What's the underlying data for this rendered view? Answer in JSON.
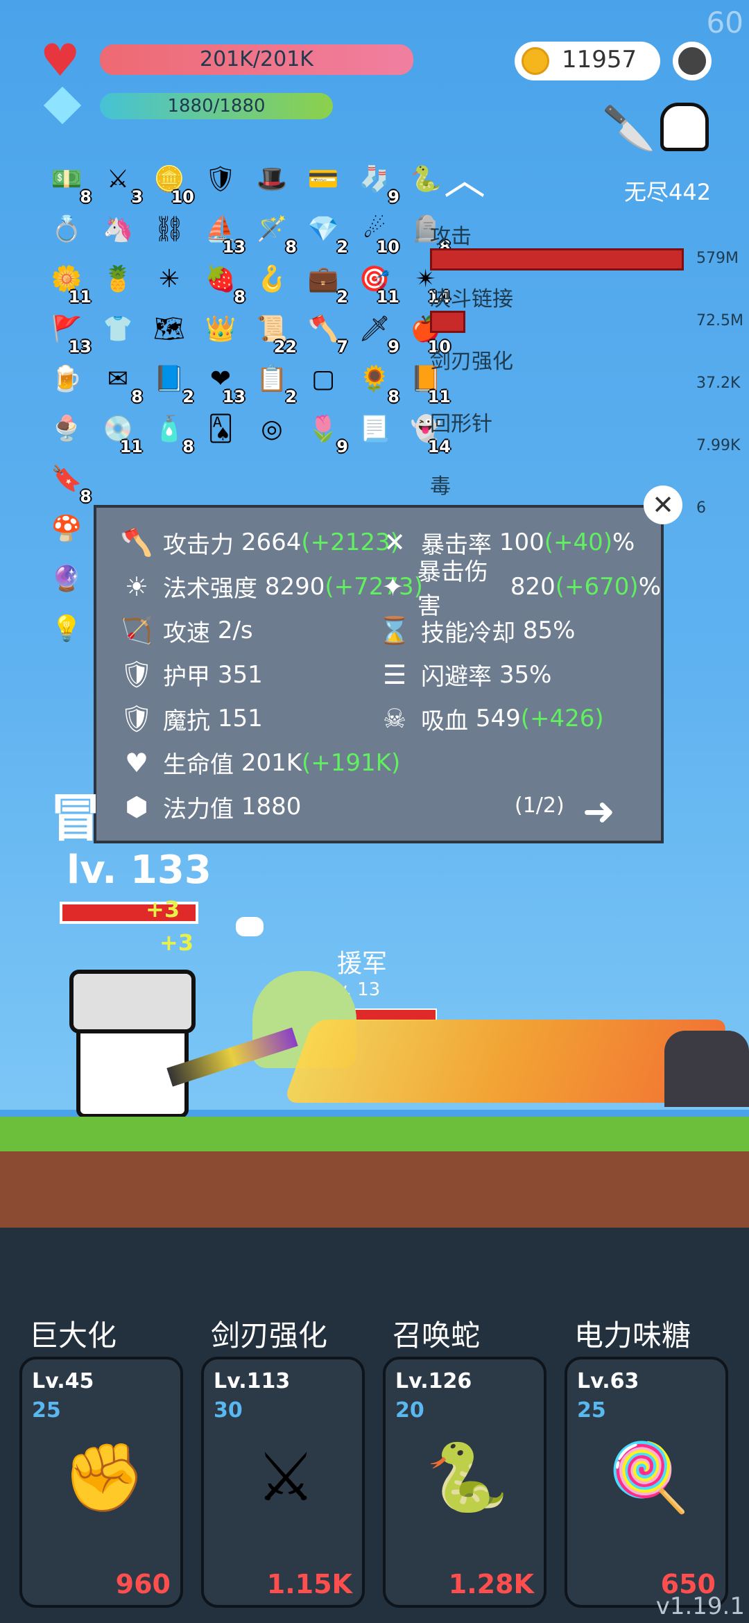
{
  "fps": "60",
  "player": {
    "hp_text": "201K/201K",
    "mp_text": "1880/1880",
    "level": "lv. 133"
  },
  "currency": {
    "coins": "11957"
  },
  "stage": {
    "label": "无尽442"
  },
  "inventory": {
    "rows": [
      [
        {
          "icon": "cash-icon",
          "glyph": "💵",
          "count": "8"
        },
        {
          "icon": "crossed-swords-icon",
          "glyph": "⚔",
          "count": "3"
        },
        {
          "icon": "coin-stack-icon",
          "glyph": "🪙",
          "count": "10"
        },
        {
          "icon": "shield-icon",
          "glyph": "🛡",
          "count": ""
        },
        {
          "icon": "wizard-hat-icon",
          "glyph": "🎩",
          "count": ""
        },
        {
          "icon": "card-icon",
          "glyph": "💳",
          "count": ""
        },
        {
          "icon": "sock-icon",
          "glyph": "🧦",
          "count": "9"
        },
        {
          "icon": "snake-icon",
          "glyph": "🐍",
          "count": ""
        }
      ],
      [
        {
          "icon": "ring-icon",
          "glyph": "💍",
          "count": ""
        },
        {
          "icon": "unicorn-icon",
          "glyph": "🦄",
          "count": ""
        },
        {
          "icon": "chain-icon",
          "glyph": "⛓",
          "count": ""
        },
        {
          "icon": "pirate-ship-icon",
          "glyph": "⛵",
          "count": "13"
        },
        {
          "icon": "wand-icon",
          "glyph": "🪄",
          "count": "8"
        },
        {
          "icon": "gem-icon",
          "glyph": "💎",
          "count": "2"
        },
        {
          "icon": "meteor-icon",
          "glyph": "☄",
          "count": "10"
        },
        {
          "icon": "tombstone-icon",
          "glyph": "🪦",
          "count": "8"
        }
      ],
      [
        {
          "icon": "flower-icon",
          "glyph": "🌼",
          "count": "11"
        },
        {
          "icon": "pineapple-icon",
          "glyph": "🍍",
          "count": ""
        },
        {
          "icon": "molecule-icon",
          "glyph": "✳",
          "count": ""
        },
        {
          "icon": "strawberry-icon",
          "glyph": "🍓",
          "count": "8"
        },
        {
          "icon": "hook-icon",
          "glyph": "🪝",
          "count": ""
        },
        {
          "icon": "briefcase-icon",
          "glyph": "💼",
          "count": "2"
        },
        {
          "icon": "wooden-shield-icon",
          "glyph": "🎯",
          "count": "11"
        },
        {
          "icon": "spike-ball-icon",
          "glyph": "✴",
          "count": "14"
        }
      ],
      [
        {
          "icon": "flag-icon",
          "glyph": "🚩",
          "count": "13"
        },
        {
          "icon": "shirt-icon",
          "glyph": "👕",
          "count": ""
        },
        {
          "icon": "map-icon",
          "glyph": "🗺",
          "count": ""
        },
        {
          "icon": "crown-icon",
          "glyph": "👑",
          "count": ""
        },
        {
          "icon": "scroll-icon",
          "glyph": "📜",
          "count": "22"
        },
        {
          "icon": "axe-icon",
          "glyph": "🪓",
          "count": "7"
        },
        {
          "icon": "sword-icon",
          "glyph": "🗡",
          "count": "9"
        },
        {
          "icon": "apple-icon",
          "glyph": "🍎",
          "count": "10"
        }
      ],
      [
        {
          "icon": "beer-icon",
          "glyph": "🍺",
          "count": ""
        },
        {
          "icon": "envelope-icon",
          "glyph": "✉",
          "count": "8"
        },
        {
          "icon": "bible-icon",
          "glyph": "📘",
          "count": "2"
        },
        {
          "icon": "heart-icon",
          "glyph": "❤",
          "count": "13"
        },
        {
          "icon": "recipe-icon",
          "glyph": "📋",
          "count": "2"
        },
        {
          "icon": "empty-slot-icon",
          "glyph": "▢",
          "count": ""
        },
        {
          "icon": "sunflower-icon",
          "glyph": "🌻",
          "count": "8"
        },
        {
          "icon": "book-icon",
          "glyph": "📙",
          "count": "11"
        }
      ],
      [
        {
          "icon": "ice-cream-icon",
          "glyph": "🍨",
          "count": ""
        },
        {
          "icon": "disc-icon",
          "glyph": "💿",
          "count": "11"
        },
        {
          "icon": "potion-icon",
          "glyph": "🧴",
          "count": "8"
        },
        {
          "icon": "playing-card-icon",
          "glyph": "🂡",
          "count": ""
        },
        {
          "icon": "target-icon",
          "glyph": "◎",
          "count": ""
        },
        {
          "icon": "potted-flower-icon",
          "glyph": "🌷",
          "count": "9"
        },
        {
          "icon": "parchment-icon",
          "glyph": "📃",
          "count": ""
        },
        {
          "icon": "ghost-icon",
          "glyph": "👻",
          "count": "14"
        }
      ],
      [
        {
          "icon": "bookmark-icon",
          "glyph": "🔖",
          "count": "8"
        }
      ],
      [
        {
          "icon": "mushroom-icon",
          "glyph": "🍄",
          "count": ""
        }
      ],
      [
        {
          "icon": "crystal-ball-icon",
          "glyph": "🔮",
          "count": ""
        }
      ],
      [
        {
          "icon": "lightbulb-icon",
          "glyph": "💡",
          "count": ""
        }
      ]
    ]
  },
  "damage": [
    {
      "name": "攻击",
      "value": "579M",
      "fill": 1.0
    },
    {
      "name": "决斗链接",
      "value": "72.5M",
      "fill": 0.125
    },
    {
      "name": "剑刃强化",
      "value": "37.2K",
      "fill": 0.0
    },
    {
      "name": "回形针",
      "value": "7.99K",
      "fill": 0.0
    },
    {
      "name": "毒",
      "value": "6",
      "fill": 0.0
    }
  ],
  "stats": {
    "left": [
      {
        "icon": "axe-icon",
        "glyph": "🪓",
        "label": "攻击力",
        "value": "2664",
        "bonus": "(+2123)"
      },
      {
        "icon": "sun-icon",
        "glyph": "☀",
        "label": "法术强度",
        "value": "8290",
        "bonus": "(+7273)"
      },
      {
        "icon": "bow-icon",
        "glyph": "🏹",
        "label": "攻速",
        "value": "2/s",
        "bonus": ""
      },
      {
        "icon": "shield-outline-icon",
        "glyph": "🛡",
        "label": "护甲",
        "value": "351",
        "bonus": ""
      },
      {
        "icon": "magic-shield-icon",
        "glyph": "🛡",
        "label": "魔抗",
        "value": "151",
        "bonus": ""
      },
      {
        "icon": "heart-icon",
        "glyph": "♥",
        "label": "生命值",
        "value": "201K",
        "bonus": "(+191K)"
      },
      {
        "icon": "crystal-icon",
        "glyph": "⬢",
        "label": "法力值",
        "value": "1880",
        "bonus": ""
      }
    ],
    "right": [
      {
        "icon": "crit-icon",
        "glyph": "✕",
        "label": "暴击率",
        "value": "100",
        "bonus": "(+40)",
        "unit": "%"
      },
      {
        "icon": "crit-damage-icon",
        "glyph": "✦",
        "label": "暴击伤害",
        "value": "820",
        "bonus": "(+670)",
        "unit": "%"
      },
      {
        "icon": "hourglass-icon",
        "glyph": "⌛",
        "label": "技能冷却",
        "value": "85%",
        "bonus": "",
        "unit": ""
      },
      {
        "icon": "dodge-icon",
        "glyph": "☰",
        "label": "闪避率",
        "value": "35%",
        "bonus": "",
        "unit": ""
      },
      {
        "icon": "skull-icon",
        "glyph": "☠",
        "label": "吸血",
        "value": "549",
        "bonus": "(+426)",
        "unit": ""
      }
    ],
    "page": "(1/2)"
  },
  "battle": {
    "ally_label": "援军",
    "ally_level": "lv. 13",
    "hit_popups": [
      "+3",
      "+3"
    ]
  },
  "skills": [
    {
      "name": "巨大化",
      "level": "Lv.45",
      "cost": "25",
      "price": "960",
      "icon": "fist-icon",
      "glyph": "✊"
    },
    {
      "name": "剑刃强化",
      "level": "Lv.113",
      "cost": "30",
      "price": "1.15K",
      "icon": "crossed-swords-icon",
      "glyph": "⚔"
    },
    {
      "name": "召唤蛇",
      "level": "Lv.126",
      "cost": "20",
      "price": "1.28K",
      "icon": "snake-icon",
      "glyph": "🐍"
    },
    {
      "name": "电力味糖",
      "level": "Lv.63",
      "cost": "25",
      "price": "650",
      "icon": "lollipop-icon",
      "glyph": "🍭"
    }
  ],
  "version": "v1.19.1",
  "colors": {
    "hp": "#ee6a73",
    "mp": "#6cc65a",
    "damage_bar": "#c82a2a",
    "bonus": "#60f060",
    "price": "#ff4e4e",
    "cost": "#5ab8f0"
  }
}
